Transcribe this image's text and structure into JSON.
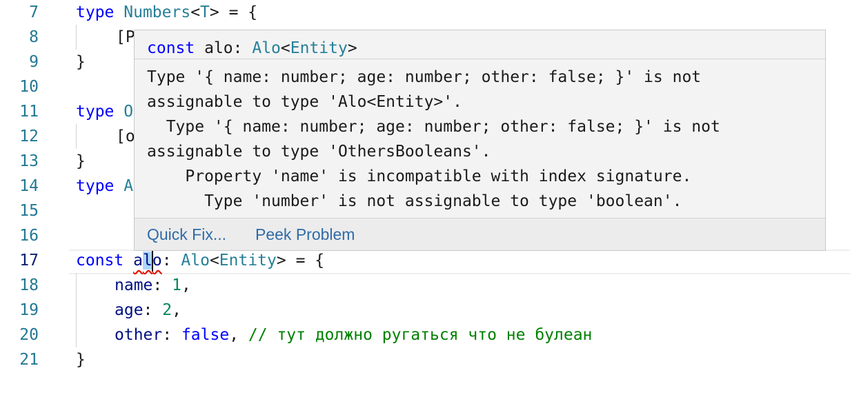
{
  "gutter": {
    "lines": [
      "7",
      "8",
      "9",
      "10",
      "11",
      "12",
      "13",
      "14",
      "15",
      "16",
      "17",
      "18",
      "19",
      "20",
      "21"
    ],
    "active": "17"
  },
  "code": {
    "l7": {
      "kw": "type",
      "name": "Numbers",
      "generic_open": "<",
      "generic_param": "T",
      "generic_close": ">",
      "rest": " = {"
    },
    "l8": {
      "text": "[P"
    },
    "l9": {
      "text": "}"
    },
    "l11": {
      "kw": "type",
      "text": "O"
    },
    "l12": {
      "text": "[o"
    },
    "l13": {
      "text": "}"
    },
    "l14": {
      "kw": "type",
      "text": "A"
    },
    "l17": {
      "kw": "const",
      "var_a": "a",
      "var_sel": "l",
      "var_b": "o",
      "colon": ": ",
      "type": "Alo",
      "generic_open": "<",
      "generic_param": "Entity",
      "generic_close": ">",
      "rest": " = {"
    },
    "l18": {
      "prop": "name",
      "colon": ": ",
      "value": "1",
      "comma": ","
    },
    "l19": {
      "prop": "age",
      "colon": ": ",
      "value": "2",
      "comma": ","
    },
    "l20": {
      "prop": "other",
      "colon": ": ",
      "value": "false",
      "comma": ", ",
      "comment": "// тут должно ругаться что не булеан"
    },
    "l21": {
      "text": "}"
    }
  },
  "hover": {
    "sig_kw": "const",
    "sig_name": " alo: ",
    "sig_type": "Alo",
    "sig_open": "<",
    "sig_param": "Entity",
    "sig_close": ">",
    "message_lines": [
      "Type '{ name: number; age: number; other: false; }' is not",
      "assignable to type 'Alo<Entity>'.",
      "  Type '{ name: number; age: number; other: false; }' is not",
      "assignable to type 'OthersBooleans'.",
      "    Property 'name' is incompatible with index signature.",
      "      Type 'number' is not assignable to type 'boolean'."
    ],
    "actions": {
      "quick_fix": "Quick Fix...",
      "peek_problem": "Peek Problem"
    }
  },
  "colors": {
    "keyword": "#0000ff",
    "type": "#267f99",
    "number": "#098658",
    "comment": "#008000",
    "line_number": "#237893",
    "error": "#e51400",
    "link": "#2f6ba7"
  }
}
